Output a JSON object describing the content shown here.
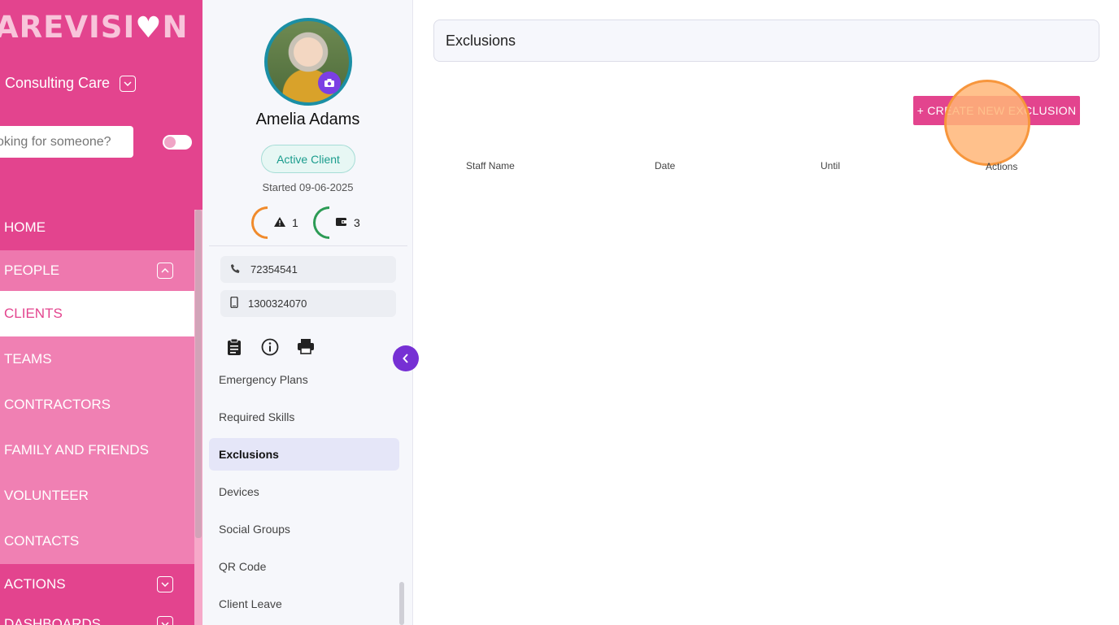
{
  "nav": {
    "logo_text": "AREVISI",
    "logo_heart": "♥",
    "logo_end": "N",
    "org_name": "Consulting Care",
    "search_placeholder": "oking for someone?",
    "items": [
      {
        "label": "HOME"
      },
      {
        "label": "PEOPLE"
      },
      {
        "label": "CLIENTS"
      },
      {
        "label": "TEAMS"
      },
      {
        "label": "CONTRACTORS"
      },
      {
        "label": "FAMILY AND FRIENDS"
      },
      {
        "label": "VOLUNTEER"
      },
      {
        "label": "CONTACTS"
      },
      {
        "label": "ACTIONS"
      },
      {
        "label": "DASHBOARDS"
      }
    ]
  },
  "profile": {
    "name": "Amelia Adams",
    "status": "Active Client",
    "started": "Started 09-06-2025",
    "alerts_count": "1",
    "wallet_count": "3",
    "phone": "72354541",
    "mobile": "1300324070",
    "menu": [
      {
        "label": "Emergency Plans"
      },
      {
        "label": "Required Skills"
      },
      {
        "label": "Exclusions"
      },
      {
        "label": "Devices"
      },
      {
        "label": "Social Groups"
      },
      {
        "label": "QR Code"
      },
      {
        "label": "Client Leave"
      }
    ]
  },
  "main": {
    "title": "Exclusions",
    "create_button": "+ CREATE NEW EXCLUSION",
    "columns": [
      "Staff Name",
      "Date",
      "Until",
      "Actions"
    ]
  },
  "colors": {
    "brand_pink": "#e3448e",
    "accent_purple": "#7630d4",
    "status_teal": "#1a9c8d"
  }
}
